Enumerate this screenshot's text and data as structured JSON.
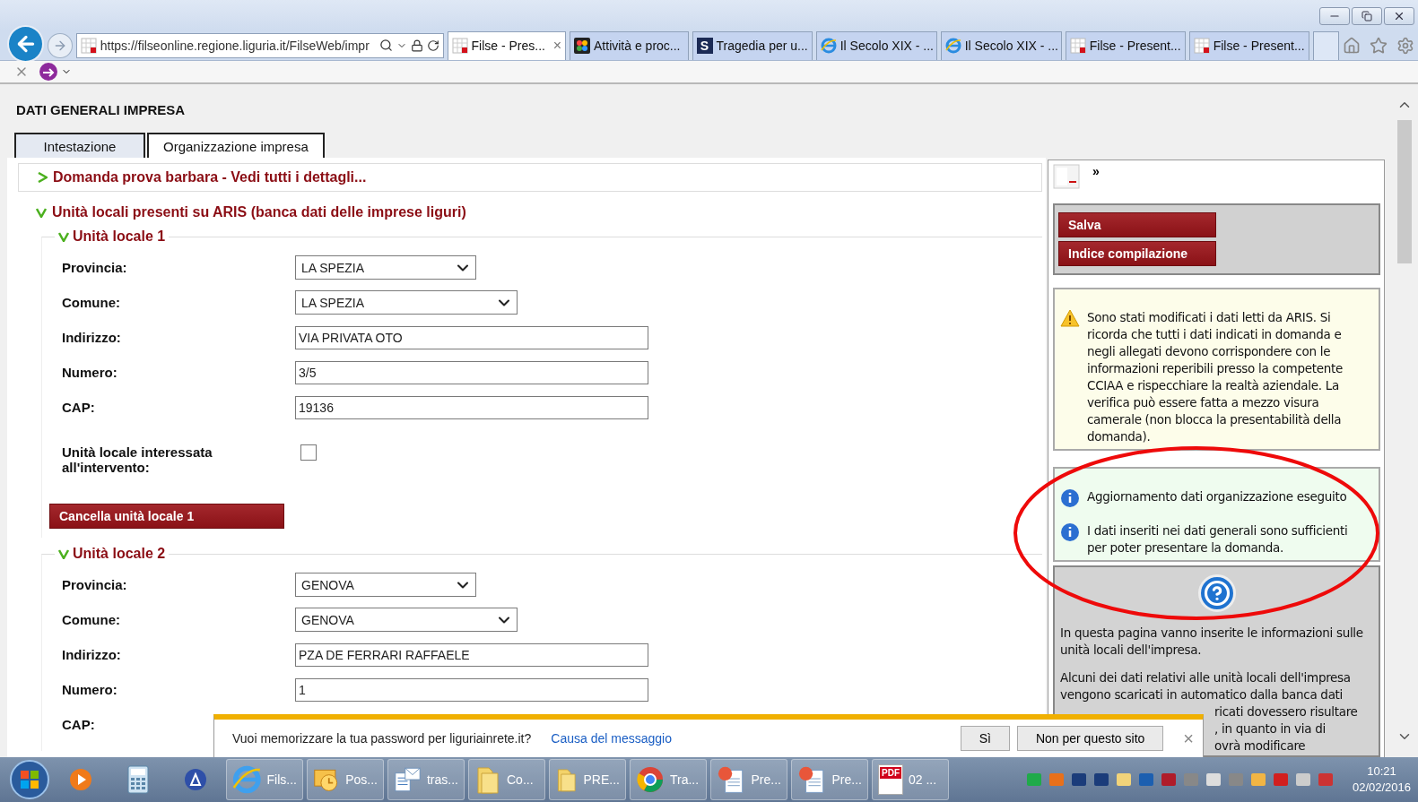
{
  "browser": {
    "address": "https://filseonline.regione.liguria.it/FilseWeb/impr",
    "tabs": [
      {
        "label": "Filse - Pres...",
        "kind": "grid",
        "selected": true,
        "close": "×"
      },
      {
        "label": "Attività e proc...",
        "kind": "dots",
        "selected": false
      },
      {
        "label": "Tragedia per u...",
        "kind": "letter",
        "letter": "S",
        "selected": false
      },
      {
        "label": "Il Secolo XIX - ...",
        "kind": "e",
        "selected": false
      },
      {
        "label": "Il Secolo XIX - ...",
        "kind": "e",
        "selected": false
      },
      {
        "label": "Filse - Present...",
        "kind": "grid",
        "selected": false
      },
      {
        "label": "Filse - Present...",
        "kind": "grid",
        "selected": false
      }
    ]
  },
  "page": {
    "title": "DATI GENERALI IMPRESA",
    "tabs": [
      {
        "label": "Intestazione",
        "selected": false
      },
      {
        "label": "Organizzazione impresa",
        "selected": true
      }
    ],
    "summary": {
      "title": "Domanda prova barbara - Vedi tutti i dettagli...",
      "expanded": false
    },
    "section": {
      "title": "Unità locali presenti su ARIS (banca dati delle imprese liguri)",
      "expanded": true
    },
    "units": [
      {
        "title": "Unità locale 1",
        "expanded": true,
        "fields": [
          {
            "label": "Provincia:",
            "kind": "select",
            "value": "LA SPEZIA"
          },
          {
            "label": "Comune:",
            "kind": "select",
            "value": "LA SPEZIA"
          },
          {
            "label": "Indirizzo:",
            "kind": "text",
            "value": "VIA PRIVATA OTO"
          },
          {
            "label": "Numero:",
            "kind": "text",
            "value": "3/5"
          },
          {
            "label": "CAP:",
            "kind": "text",
            "value": "19136"
          },
          {
            "label": "Unità locale interessata all'intervento:",
            "kind": "checkbox",
            "checked": false
          }
        ],
        "delete_button": "Cancella unità locale 1"
      },
      {
        "title": "Unità locale 2",
        "expanded": true,
        "fields": [
          {
            "label": "Provincia:",
            "kind": "select",
            "value": "GENOVA"
          },
          {
            "label": "Comune:",
            "kind": "select",
            "value": "GENOVA"
          },
          {
            "label": "Indirizzo:",
            "kind": "text",
            "value": "PZA DE FERRARI RAFFAELE"
          },
          {
            "label": "Numero:",
            "kind": "text",
            "value": "1"
          },
          {
            "label": "CAP:",
            "kind": "hidden"
          }
        ]
      }
    ]
  },
  "side_panel": {
    "toggle": "»",
    "buttons": [
      "Salva",
      "Indice compilazione"
    ],
    "warning": "Sono stati modificati i dati letti da ARIS. Si ricorda che tutti i dati indicati in domanda e negli allegati devono corrispondere con le informazioni reperibili presso la competente CCIAA e rispecchiare la realtà aziendale. La verifica può essere fatta a mezzo visura camerale (non blocca la presentabilità della domanda).",
    "infos": [
      "Aggiornamento dati organizzazione eseguito",
      "I dati inseriti nei dati generali sono sufficienti per poter presentare la domanda."
    ],
    "help": [
      {
        "kind": "full",
        "text": "In questa pagina vanno inserite le informazioni sulle unità locali dell'impresa."
      },
      {
        "kind": "full",
        "text": "Alcuni dei dati relativi alle unità locali dell'impresa vengono scaricati in automatico dalla banca dati"
      },
      {
        "kind": "partial",
        "text": "ricati dovessero risultare"
      },
      {
        "kind": "partial",
        "text": ", in quanto in via di"
      },
      {
        "kind": "partial",
        "text": "ovrà modificare"
      }
    ]
  },
  "notification": {
    "text": "Vuoi memorizzare la tua password per liguriainrete.it?",
    "link": "Causa del messaggio",
    "buttons": [
      "Sì",
      "Non per questo sito"
    ],
    "close": "×"
  },
  "taskbar": {
    "items": [
      {
        "label": "Fils...",
        "kind": "e"
      },
      {
        "label": "Pos...",
        "kind": "clock"
      },
      {
        "label": "tras...",
        "kind": "mail"
      },
      {
        "label": "Co...",
        "kind": "folder"
      },
      {
        "label": "PRE...",
        "kind": "folder"
      },
      {
        "label": "Tra...",
        "kind": "chrome"
      },
      {
        "label": "Pre...",
        "kind": "slides"
      },
      {
        "label": "Pre...",
        "kind": "slides"
      },
      {
        "label": "02 ...",
        "kind": "pdf",
        "badge": "PDF"
      }
    ],
    "time": "10:21",
    "date": "02/02/2016"
  }
}
